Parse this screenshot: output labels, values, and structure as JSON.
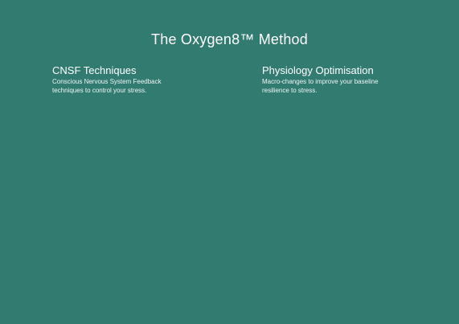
{
  "header": {
    "title": "The Oxygen8™ Method"
  },
  "columns": [
    {
      "title": "CNSF Techniques",
      "description": "Conscious Nervous System Feedback techniques to control your stress."
    },
    {
      "title": "Physiology Optimisation",
      "description": "Macro-changes to improve your baseline resilience to stress."
    }
  ],
  "colors": {
    "background": "#327b71",
    "text": "#ffffff"
  }
}
